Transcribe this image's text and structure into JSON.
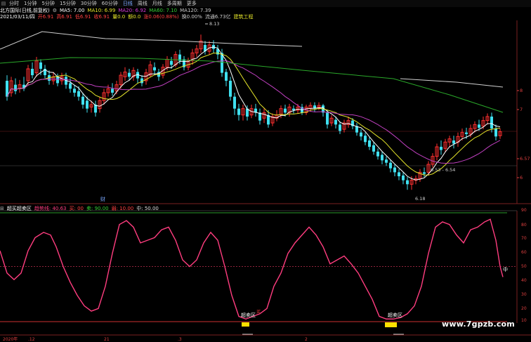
{
  "toolbar": {
    "tabs": [
      "分时",
      "1分钟",
      "5分钟",
      "15分钟",
      "30分钟",
      "60分钟",
      "日线",
      "周线",
      "月线",
      "多周期",
      "更多"
    ]
  },
  "header": {
    "title": "北方国际(日线,前复权)",
    "ma": [
      {
        "label": "MA5: 7.00",
        "color": "#ffffff"
      },
      {
        "label": "MA10: 6.99",
        "color": "#e5e52a"
      },
      {
        "label": "MA20: 6.92",
        "color": "#d63ad6"
      },
      {
        "label": "MA60: 7.10",
        "color": "#33cc33"
      },
      {
        "label": "MA120: 7.39",
        "color": "#c8c8c8"
      }
    ]
  },
  "info": {
    "date": "2021/03/11/四",
    "open": "开6.91",
    "high": "高6.91",
    "low": "低6.91",
    "close": "收6.91",
    "volume": "量0.0",
    "amount": "额0.0",
    "change": "涨0.06(0.88%)",
    "turnover": "换0.00%",
    "flow": "流通6.73亿",
    "industry": "建筑工程"
  },
  "main_price_labels": {
    "high": "8.13",
    "low": "6.18",
    "range": "6.53 - 6.54"
  },
  "axis": {
    "right": [
      "8",
      "7",
      "6.57",
      "6"
    ],
    "sub_right": [
      "90",
      "80",
      "70",
      "60",
      "50",
      "40",
      "30",
      "20",
      "10"
    ],
    "sub_mid": "中"
  },
  "sub_header": {
    "name": "超买超卖区",
    "trend": "趋势线: 40.63",
    "buy": "买: 00",
    "sell_label": "卖: 90.00",
    "weak": "弱: 10.00",
    "mid": "中: 50.00"
  },
  "annotations": {
    "zone1": "超卖区",
    "zone2": "超卖区",
    "buy1": "买",
    "marker": "财"
  },
  "bottom_axis": [
    "2020年",
    ".12",
    "21",
    ".3",
    "2"
  ],
  "watermark": "www.7gpzb.com",
  "colors": {
    "up": "#ff3030",
    "down": "#40e0f0",
    "ma5": "#ffffff",
    "ma10": "#e5e52a",
    "ma20": "#c040c0",
    "ma60": "#2aa82a",
    "ma120": "#d0d0d0",
    "osc": "#ff3d7f",
    "zone": "#ffe000"
  }
}
